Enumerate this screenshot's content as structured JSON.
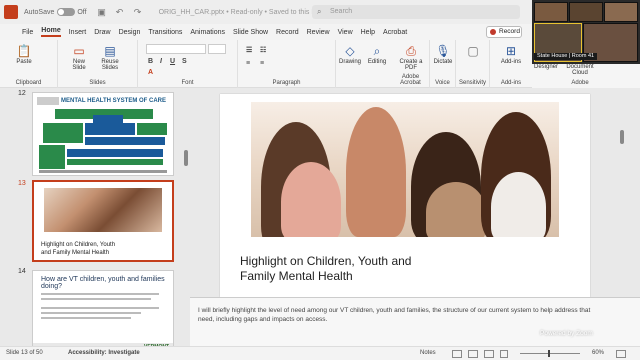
{
  "titlebar": {
    "autosave_label": "AutoSave",
    "autosave_state": "Off",
    "filename": "ORIG_HH_CAR.pptx • Read-only • Saved to this PC",
    "search_placeholder": "Search"
  },
  "menu": {
    "tabs": [
      "File",
      "Home",
      "Insert",
      "Draw",
      "Design",
      "Transitions",
      "Animations",
      "Slide Show",
      "Record",
      "Review",
      "View",
      "Help",
      "Acrobat"
    ],
    "active": "Home",
    "record_label": "Record"
  },
  "ribbon": {
    "clipboard": {
      "paste": "Paste",
      "group": "Clipboard"
    },
    "slides": {
      "new_slide": "New Slide",
      "reuse_slides": "Reuse Slides",
      "group": "Slides"
    },
    "font": {
      "group": "Font"
    },
    "paragraph": {
      "group": "Paragraph"
    },
    "drawing": {
      "label": "Drawing"
    },
    "editing": {
      "label": "Editing"
    },
    "acrobat": {
      "label": "Create a PDF",
      "group": "Adobe Acrobat"
    },
    "voice": {
      "label": "Dictate",
      "group": "Voice"
    },
    "sensitivity": {
      "label": "Sensitivity",
      "group": "Sensitivity"
    },
    "addins": {
      "label": "Add-ins",
      "group": "Add-ins"
    },
    "designer": {
      "label": "Designer"
    },
    "doccloud": {
      "label": "Document Cloud",
      "group": "Adobe"
    }
  },
  "video": {
    "label": "State House | Room 41"
  },
  "slides_panel": {
    "items": [
      {
        "number": "12",
        "title": "MENTAL HEALTH SYSTEM OF CARE"
      },
      {
        "number": "13",
        "title": "Highlight on Children, Youth and Family Mental Health"
      },
      {
        "number": "14",
        "title": "How are VT children, youth and families doing?",
        "logo": "VERMONT"
      }
    ]
  },
  "slide": {
    "title": "Highlight on Children, Youth and Family Mental Health"
  },
  "notes": {
    "text": "I will briefly highlight the level of need among our VT children, youth and families, the structure of our current system to help address that need, including gaps and impacts on access."
  },
  "overlay": {
    "powered": "Powered by Zoom"
  },
  "status": {
    "slide_counter": "Slide 13 of 50",
    "accessibility": "Accessibility: Investigate",
    "notes": "Notes",
    "zoom": "60%"
  },
  "colors": {
    "accent": "#c43e1c",
    "brand_blue": "#2b579a"
  }
}
